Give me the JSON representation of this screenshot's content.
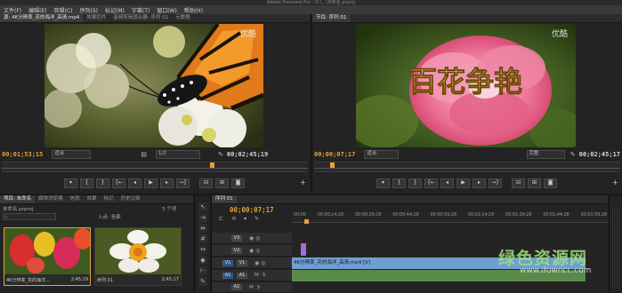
{
  "window": {
    "title": "Adobe Premiere Pro - D:\\...\\未命名.prproj"
  },
  "menu": [
    "文件(F)",
    "编辑(E)",
    "剪辑(C)",
    "序列(S)",
    "标记(M)",
    "字幕(T)",
    "窗口(W)",
    "帮助(H)"
  ],
  "source": {
    "tabs": [
      "源: 4K分辨率_花的海洋_高清.mp4",
      "效果控件",
      "音频剪辑混合器: 序列 01",
      "元数据"
    ],
    "timecode_in": "00;01;53;15",
    "fit": "适合",
    "ratio": "1/2",
    "timecode_out": "00;02;45;19",
    "logo": "优酷"
  },
  "program": {
    "tabs": [
      "节目: 序列 01"
    ],
    "timecode_in": "00;00;07;17",
    "fit": "适合",
    "quality": "完整",
    "timecode_out": "00;02;45;17",
    "title_text": "百花争艳",
    "logo": "优酷"
  },
  "project": {
    "tabs": [
      "项目: 未命名",
      "媒体浏览器",
      "信息",
      "效果",
      "标记",
      "历史记录"
    ],
    "name": "未命名.prproj",
    "count": "3 个项",
    "entry_label": "入点: 全部",
    "items": [
      {
        "label": "4K分辨率_花的海洋...",
        "duration": "2;45;19"
      },
      {
        "label": "序列 01",
        "duration": "2;45;17"
      }
    ]
  },
  "timeline": {
    "tab": "序列 01",
    "timecode": "00;00;07;17",
    "ruler": [
      "00;00",
      "00;00;14;29",
      "00;00;29;29",
      "00;00;44;28",
      "00;00;59;28",
      "00;01;14;29",
      "00;01;29;29",
      "00;01;44;28",
      "00;01;59;28"
    ],
    "video_tracks": [
      "V3",
      "V2",
      "V1"
    ],
    "audio_tracks": [
      "A1",
      "A2",
      "A3"
    ],
    "clip_label": "4K分辨率_花的海洋_高清.mp4 [V]",
    "mute": "M",
    "solo": "S"
  },
  "watermark": {
    "cn": "绿色资源网",
    "url": "www.downcc.com"
  }
}
